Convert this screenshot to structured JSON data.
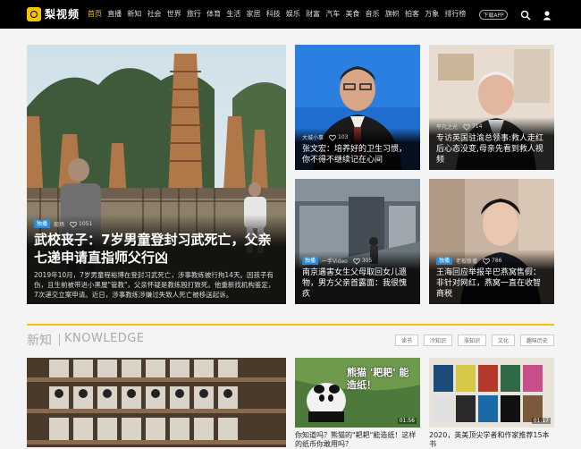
{
  "header": {
    "logo_text": "梨视频",
    "nav": [
      "首页",
      "直播",
      "新知",
      "社会",
      "世界",
      "旅行",
      "体育",
      "生活",
      "家居",
      "科技",
      "娱乐",
      "财富",
      "汽车",
      "美食",
      "音乐",
      "旗帜",
      "拍客",
      "万象",
      "排行榜"
    ],
    "active_nav": "首页",
    "download_label": "下载APP",
    "accent": "#f6c300"
  },
  "featured": {
    "tag": "独播",
    "source": "现场",
    "likes": "1051",
    "title": "武校丧子：7岁男童登封习武死亡，父亲七递申请直指师父行凶",
    "desc": "2019年10月，7岁男童程裕博在登封习武死亡，涉事教练被行拘14天。因孩子有伤，且生前被带进小黑屋\"管教\"，父亲怀疑是教练殴打致死。他重新找机构鉴定，7次递交立案申请。近日，涉事教练涉嫌过失致人死亡被移送起诉。"
  },
  "cards": [
    {
      "source": "大城小事",
      "likes": "103",
      "title": "张文宏：培养好的卫生习惯，你不得不继续记在心间"
    },
    {
      "source": "平凡之光",
      "likes": "714",
      "title": "专访英国驻渝总领事:救人走红后心态没变,母亲先看到救人视频"
    },
    {
      "tag": "独播",
      "source": "一手Video",
      "likes": "305",
      "title": "南京遇害女生父母取回女儿遗物，男方父亲首露面：我很愧疚"
    },
    {
      "tag": "独播",
      "source": "老板联播",
      "likes": "786",
      "title": "王海回应举报辛巴燕窝售假：非针对网红，燕窝一直在收智商税"
    }
  ],
  "knowledge": {
    "title_cn": "新知",
    "title_en": "KNOWLEDGE",
    "chips": [
      "读书",
      "冷知识",
      "涨知识",
      "文化",
      "趣味历史"
    ],
    "items": [
      {
        "title": ""
      },
      {
        "overlay": "熊猫 '耙耙' 能造纸！",
        "duration": "01:56",
        "title": "你知道吗？熊猫的\"耙耙\"能造纸！这样的纸币你敢用吗？"
      },
      {
        "duration": "01:17",
        "title": "2020，英美顶尖学者和作家推荐15本书"
      }
    ]
  }
}
